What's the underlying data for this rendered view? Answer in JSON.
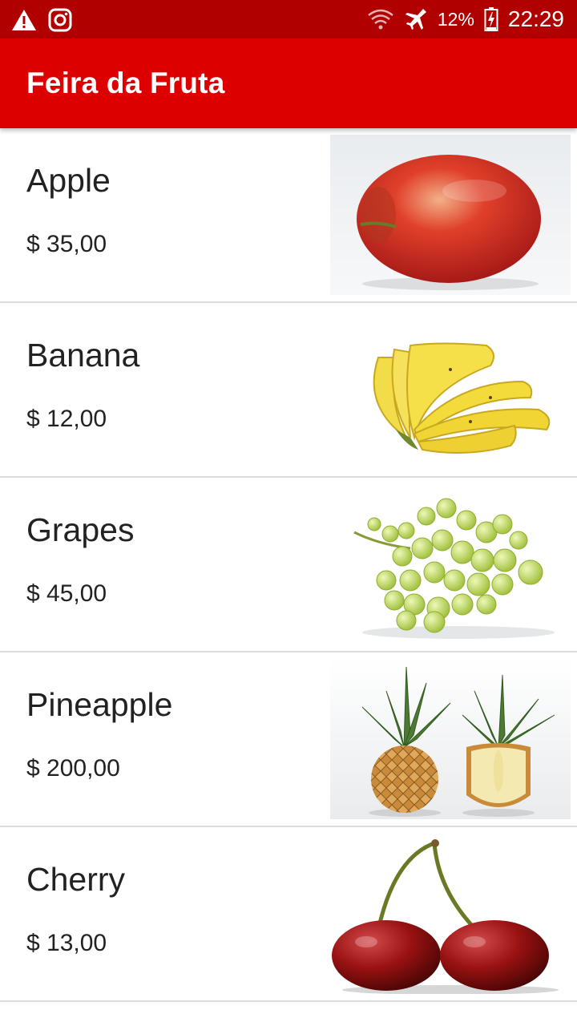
{
  "status_bar": {
    "battery_percent": "12%",
    "time": "22:29",
    "left_icons": [
      "warning-icon",
      "instagram-icon"
    ],
    "right_icons": [
      "wifi-icon",
      "airplane-icon",
      "battery-charging-icon"
    ]
  },
  "app_bar": {
    "title": "Feira da Fruta",
    "color": "#dd0000"
  },
  "fruits": [
    {
      "name": "Apple",
      "price": "$ 35,00",
      "image_icon": "apple-image"
    },
    {
      "name": "Banana",
      "price": "$ 12,00",
      "image_icon": "banana-image"
    },
    {
      "name": "Grapes",
      "price": "$ 45,00",
      "image_icon": "grapes-image"
    },
    {
      "name": "Pineapple",
      "price": "$ 200,00",
      "image_icon": "pineapple-image"
    },
    {
      "name": "Cherry",
      "price": "$ 13,00",
      "image_icon": "cherry-image"
    }
  ]
}
